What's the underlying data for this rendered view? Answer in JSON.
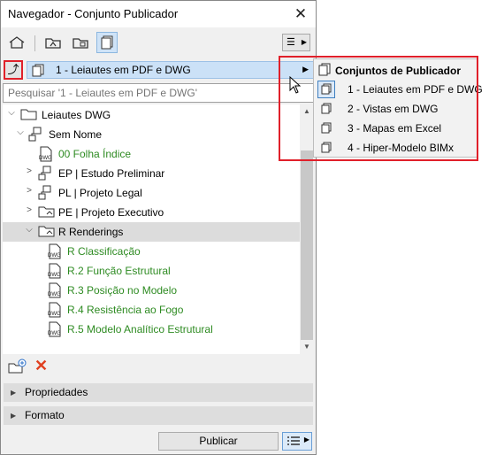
{
  "window": {
    "title": "Navegador - Conjunto Publicador",
    "close_label": "✕"
  },
  "toolbar": {
    "icons": [
      "project-map-icon",
      "view-map-icon",
      "layout-book-icon",
      "publisher-sets-icon"
    ],
    "active": "publisher-sets-icon",
    "menu_label": "☰"
  },
  "publisher": {
    "current_set": "1 - Leiautes em PDF e DWG",
    "search_placeholder": "Pesquisar '1 - Leiautes em PDF e DWG'"
  },
  "tree": {
    "root_label": "Leiautes DWG",
    "sem_nome_label": "Sem Nome",
    "items": [
      {
        "label": "00 Folha Índice",
        "type": "dwg"
      },
      {
        "label": "EP | Estudo Preliminar",
        "type": "folder"
      },
      {
        "label": "PL | Projeto Legal",
        "type": "folder"
      },
      {
        "label": "PE | Projeto Executivo",
        "type": "folder"
      },
      {
        "label": "R Renderings",
        "type": "folder"
      }
    ],
    "renderings_children": [
      "R Classificação",
      "R.2 Função Estrutural",
      "R.3 Posição no Modelo",
      "R.4 Resistência ao Fogo",
      "R.5 Modelo Analítico Estrutural"
    ]
  },
  "panels": {
    "properties_label": "Propriedades",
    "format_label": "Formato"
  },
  "footer": {
    "publish_label": "Publicar"
  },
  "popup": {
    "header": "Conjuntos de Publicador",
    "items": [
      "1 - Leiautes em PDF e DWG",
      "2 - Vistas em DWG",
      "3 - Mapas em Excel",
      "4 - Hiper-Modelo BIMx"
    ],
    "checked_index": 0
  },
  "colors": {
    "highlight_red": "#e0202a",
    "selection_blue": "#cbe1f7",
    "green_text": "#2e8b22"
  }
}
